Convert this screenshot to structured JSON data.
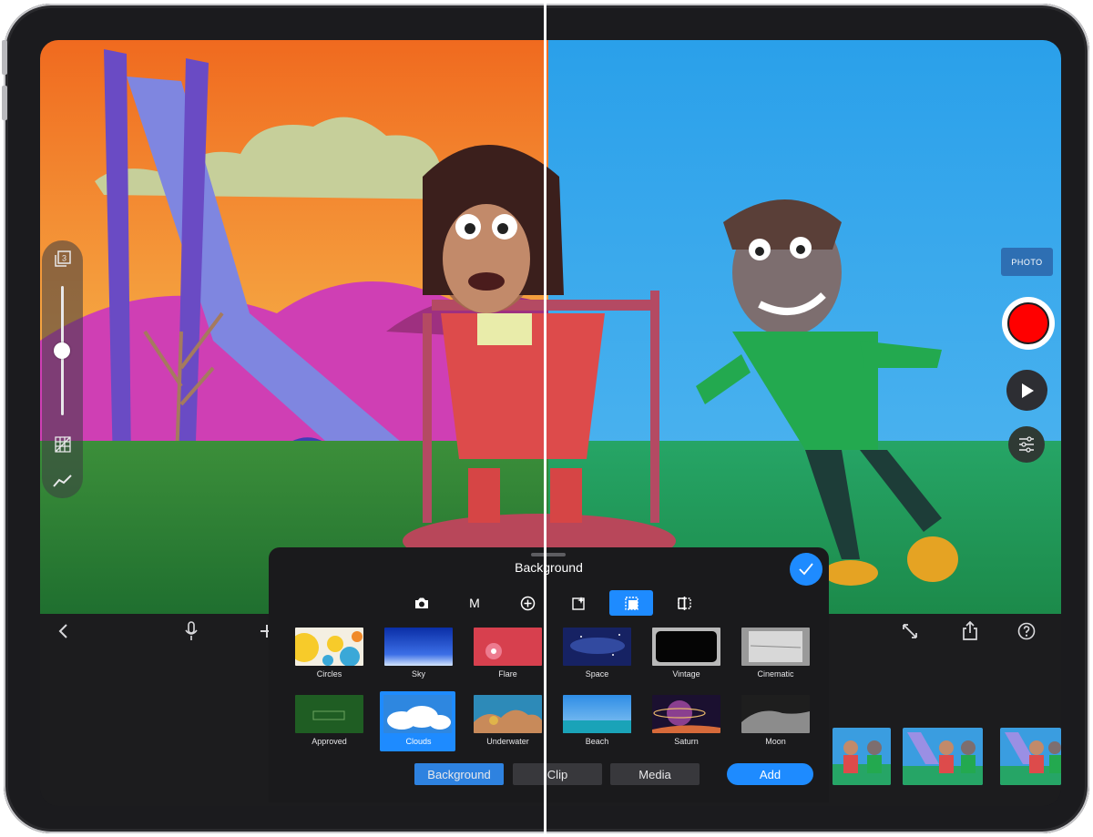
{
  "panel": {
    "title": "Background",
    "mode_tabs": [
      {
        "icon": "camera-icon",
        "label": ""
      },
      {
        "icon": "m-letter-icon",
        "label": "M"
      },
      {
        "icon": "plus-circle-icon",
        "label": ""
      },
      {
        "icon": "sparkle-square-icon",
        "label": ""
      },
      {
        "icon": "dashed-square-icon",
        "label": "",
        "active": true
      },
      {
        "icon": "split-compare-icon",
        "label": ""
      }
    ],
    "tiles": [
      {
        "label": "Circles"
      },
      {
        "label": "Sky"
      },
      {
        "label": "Flare"
      },
      {
        "label": "Space"
      },
      {
        "label": "Vintage"
      },
      {
        "label": "Cinematic"
      },
      {
        "label": "Approved"
      },
      {
        "label": "Clouds",
        "selected": true
      },
      {
        "label": "Underwater"
      },
      {
        "label": "Beach"
      },
      {
        "label": "Saturn"
      },
      {
        "label": "Moon"
      }
    ],
    "segments": [
      "Background",
      "Clip",
      "Media"
    ],
    "active_segment": "Background",
    "add_label": "Add"
  },
  "camera": {
    "photo_label": "PHOTO",
    "layer_count": "3",
    "slider_level": 0.5
  },
  "colors": {
    "accent": "#1e8bff",
    "record": "#ff0000",
    "panel_bg": "#1a1a1c"
  }
}
